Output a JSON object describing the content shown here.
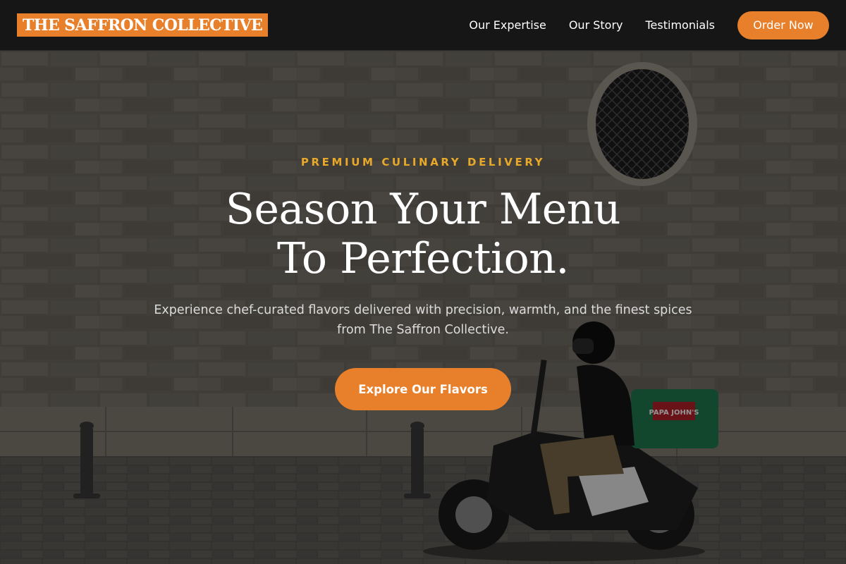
{
  "brand": {
    "logo_text": "THE SAFFRON COLLECTIVE",
    "accent_color": "#e8802b"
  },
  "nav": {
    "links": [
      "Our Expertise",
      "Our Story",
      "Testimonials"
    ],
    "cta_label": "Order Now"
  },
  "hero": {
    "eyebrow": "PREMIUM CULINARY DELIVERY",
    "headline_line1": "Season Your Menu",
    "headline_line2": "To Perfection.",
    "subtext_line1": "Experience chef-curated flavors delivered with precision, warmth, and the finest spices",
    "subtext_line2": "from The Saffron Collective.",
    "cta_label": "Explore Our Flavors",
    "background_image": {
      "box_label": "PAPA JOHN'S"
    }
  }
}
